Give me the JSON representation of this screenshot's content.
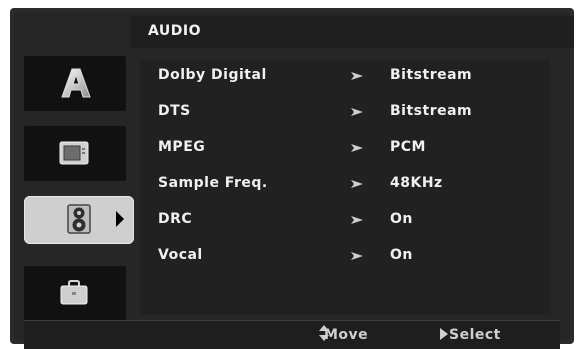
{
  "header": {
    "title": "AUDIO"
  },
  "menu": {
    "rows": [
      {
        "label": "Dolby Digital",
        "value": "Bitstream"
      },
      {
        "label": "DTS",
        "value": "Bitstream"
      },
      {
        "label": "MPEG",
        "value": "PCM"
      },
      {
        "label": "Sample Freq.",
        "value": "48KHz"
      },
      {
        "label": "DRC",
        "value": "On"
      },
      {
        "label": "Vocal",
        "value": "On"
      }
    ]
  },
  "tabs": [
    {
      "icon": "letter-a-icon"
    },
    {
      "icon": "tv-icon"
    },
    {
      "icon": "speaker-icon",
      "active": true
    },
    {
      "icon": "briefcase-icon"
    }
  ],
  "footer": {
    "move_label": "Move",
    "select_label": "Select"
  },
  "colors": {
    "background": "#262626",
    "text": "#f0f0f0",
    "active_tab": "#cfcfcf",
    "muted": "#cfcfcf"
  }
}
